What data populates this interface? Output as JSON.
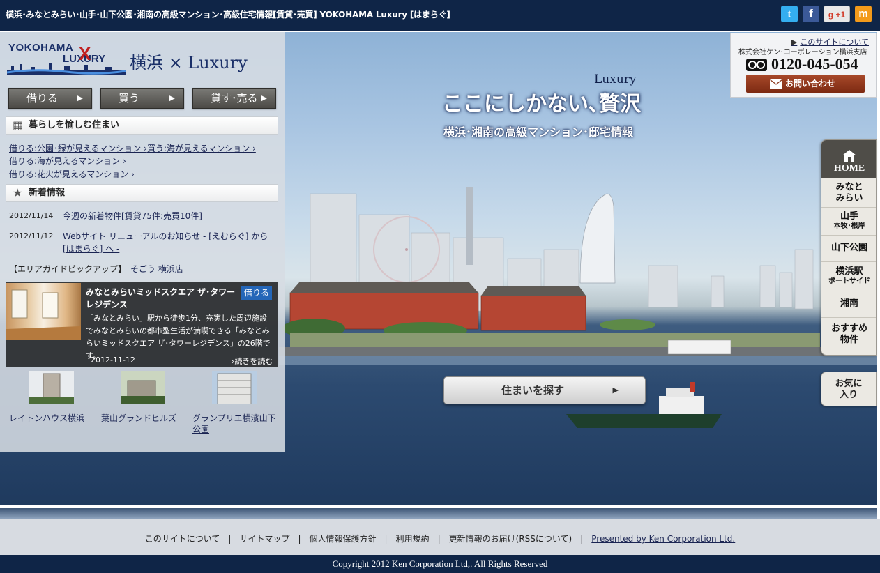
{
  "header": {
    "title": "横浜･みなとみらい･山手･山下公園･湘南の高級マンション･高級住宅情報[賃貸･売買] YOKOHAMA Luxury [はまらぐ]",
    "social": {
      "twitter": "t",
      "facebook": "f",
      "google": "g +1",
      "mixi": "m"
    }
  },
  "logo": {
    "en_line1": "YOKOHAMA",
    "en_line2": "LUXURY",
    "x_mark": "X",
    "jp": "横浜 × Luxury"
  },
  "nav": {
    "rent": "借りる",
    "buy": "買う",
    "sell": "貸す･売る",
    "arrow": "▶"
  },
  "life_section": {
    "title": "暮らしを愉しむ住まい",
    "links": [
      "借りる:公園･緑が見えるマンション ›",
      "買う:海が見えるマンション ›",
      "借りる:海が見えるマンション ›",
      "借りる:花火が見えるマンション ›"
    ]
  },
  "news_section": {
    "title": "新着情報",
    "items": [
      {
        "date": "2012/11/14",
        "text": "今週の新着物件[賃貸75件:売買10件]"
      },
      {
        "date": "2012/11/12",
        "text": "Webサイト リニューアルのお知らせ - [えむらぐ] から [はまらぐ] へ -"
      }
    ]
  },
  "pickup": {
    "label": "【エリアガイドピックアップ】",
    "link": "そごう 横浜店"
  },
  "feature": {
    "title": "みなとみらいミッドスクエア ザ･タワーレジデンス",
    "tag": "借りる",
    "desc": "「みなとみらい」駅から徒歩1分、充実した周辺施設でみなとみらいの都市型生活が満喫できる「みなとみらいミッドスクエア ザ･タワーレジデンス」の26階です。",
    "date": "2012-11-12",
    "more": "›続きを読む"
  },
  "thumbs": [
    {
      "caption": "レイトンハウス横浜"
    },
    {
      "caption": "葉山グランドヒルズ"
    },
    {
      "caption": "グランプリエ横濱山下公園"
    }
  ],
  "hero": {
    "luxury": "Luxury",
    "main": "ここにしかない､贅沢",
    "sub": "横浜･湘南の高級マンション･邸宅情報",
    "search": "住まいを探す",
    "arrow": "▶"
  },
  "contact": {
    "about": "このサイトについて",
    "about_arrow": "▶",
    "company": "株式会社ケン･コーポレーション横浜支店",
    "phone": "0120-045-054",
    "inquiry": "お問い合わせ"
  },
  "rightnav": {
    "home": "HOME",
    "items": [
      {
        "label": "みなと\nみらい",
        "small": ""
      },
      {
        "label": "山手",
        "small": "本牧･根岸"
      },
      {
        "label": "山下公園",
        "small": ""
      },
      {
        "label": "横浜駅",
        "small": "ポートサイド"
      },
      {
        "label": "湘南",
        "small": ""
      },
      {
        "label": "おすすめ\n物件",
        "small": ""
      }
    ],
    "favorite": "お気に\n入り"
  },
  "footer": {
    "links": [
      "このサイトについて",
      "サイトマップ",
      "個人情報保護方針",
      "利用規約",
      "更新情報のお届け(RSSについて)"
    ],
    "presented": "Presented by Ken Corporation Ltd.",
    "copyright": "Copyright 2012 Ken Corporation Ltd,. All Rights Reserved"
  },
  "colors": {
    "header_bg": "#0f2547",
    "accent_blue": "#2466b8",
    "inquiry_brown": "#8a3418"
  }
}
